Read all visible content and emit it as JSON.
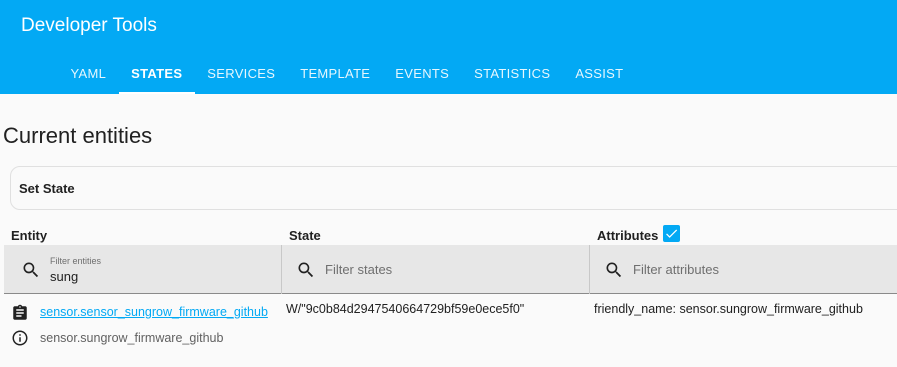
{
  "header": {
    "title": "Developer Tools",
    "background_color": "#03a9f4",
    "tabs": [
      {
        "label": "YAML",
        "active": false
      },
      {
        "label": "STATES",
        "active": true
      },
      {
        "label": "SERVICES",
        "active": false
      },
      {
        "label": "TEMPLATE",
        "active": false
      },
      {
        "label": "EVENTS",
        "active": false
      },
      {
        "label": "STATISTICS",
        "active": false
      },
      {
        "label": "ASSIST",
        "active": false
      }
    ]
  },
  "main": {
    "title": "Current entities",
    "set_state_label": "Set State",
    "columns": {
      "entity": "Entity",
      "state": "State",
      "attributes": "Attributes",
      "attributes_checked": true
    },
    "filters": {
      "entity": {
        "label": "Filter entities",
        "value": "sung",
        "icon": "search-icon"
      },
      "state": {
        "placeholder": "Filter states",
        "value": "",
        "icon": "search-icon"
      },
      "attributes": {
        "placeholder": "Filter attributes",
        "value": "",
        "icon": "search-icon"
      }
    },
    "rows": [
      {
        "entity_id": "sensor.sensor_sungrow_firmware_github",
        "friendly_name": "sensor.sungrow_firmware_github",
        "state": "W/\"9c0b84d2947540664729bf59e0ece5f0\"",
        "attributes": "friendly_name: sensor.sungrow_firmware_github",
        "icons": [
          "clipboard-icon",
          "info-icon"
        ]
      }
    ]
  },
  "colors": {
    "accent": "#03a9f4",
    "text": "#212121",
    "secondary_text": "#616161",
    "filter_bg": "#e7e7e7"
  }
}
